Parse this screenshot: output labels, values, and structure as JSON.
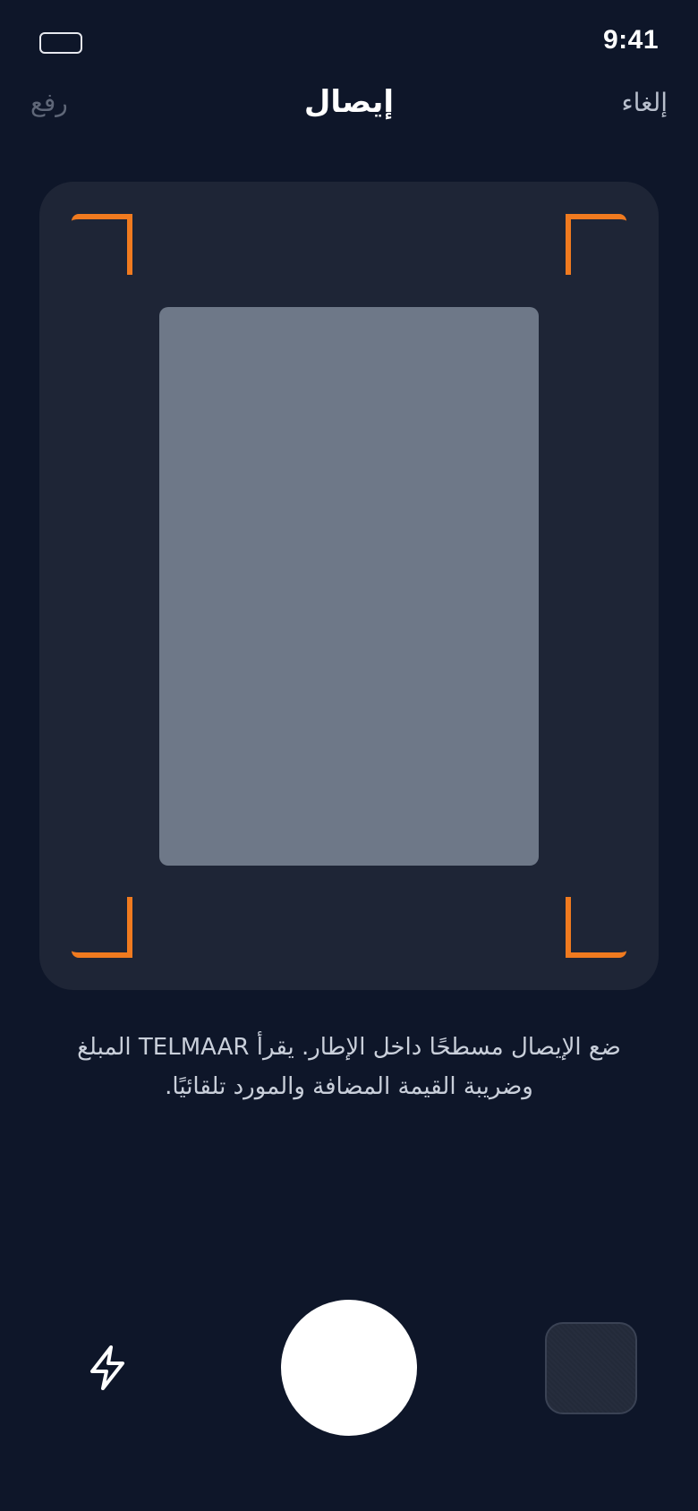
{
  "status_bar": {
    "time": "9:41",
    "battery_icon": "battery-icon"
  },
  "nav": {
    "cancel_label": "إلغاء",
    "title": "إيصال",
    "upload_label": "رفع"
  },
  "viewfinder": {
    "corner_color": "#f07a1f",
    "placeholder_color": "#6e7888"
  },
  "hint": {
    "text": "ضع الإيصال مسطحًا داخل الإطار. يقرأ TELMAAR المبلغ وضريبة القيمة المضافة والمورد تلقائيًا."
  },
  "controls": {
    "flash_icon": "flash-icon",
    "shutter": "shutter-button",
    "gallery": "gallery-thumbnail"
  },
  "colors": {
    "background": "#0e1629",
    "card": "#1e2536",
    "accent": "#f07a1f"
  }
}
